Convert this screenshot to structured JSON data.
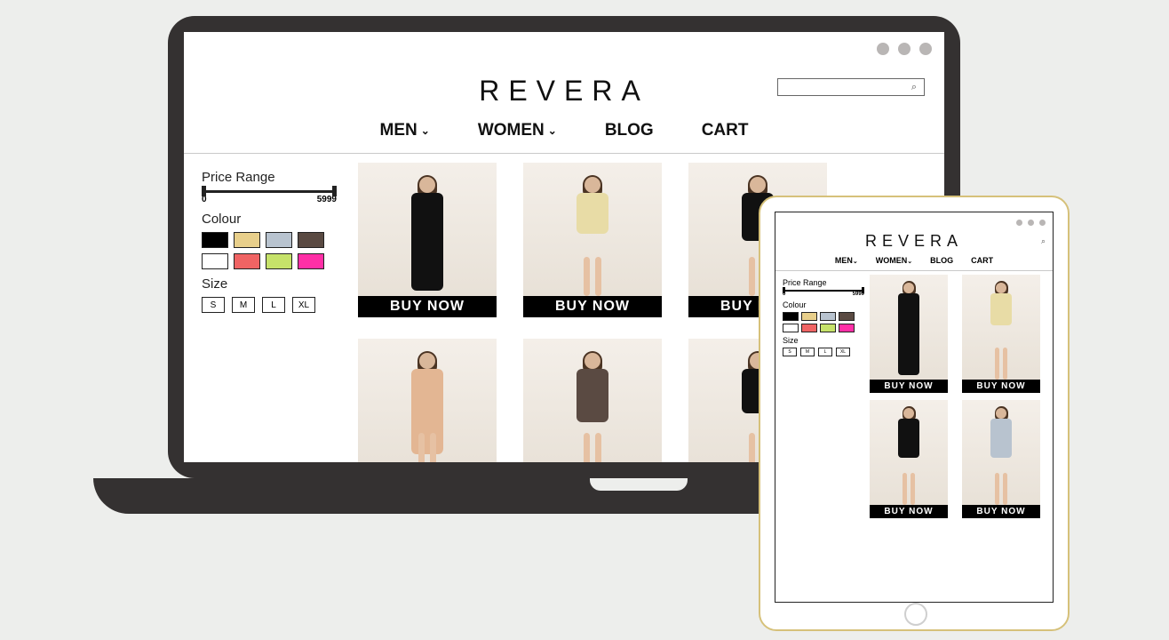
{
  "brand": "REVERA",
  "nav": {
    "men": "MEN",
    "women": "WOMEN",
    "blog": "BLOG",
    "cart": "CART"
  },
  "search": {
    "placeholder": ""
  },
  "filters": {
    "price_label": "Price Range",
    "price_min": "0",
    "price_max": "5999",
    "colour_label": "Colour",
    "colours": [
      "#000000",
      "#e8cf8b",
      "#b8c3cf",
      "#5a4a42",
      "#ffffff",
      "#f06464",
      "#c6e26a",
      "#ff2fa6"
    ],
    "size_label": "Size",
    "sizes": [
      "S",
      "M",
      "L",
      "XL"
    ]
  },
  "buy_label": "BUY NOW",
  "laptop_products": [
    {
      "dress_color": "#111",
      "dress_h": 110,
      "legs": false
    },
    {
      "dress_color": "#e8dca6",
      "dress_h": 46,
      "legs": true
    },
    {
      "dress_color": "#111",
      "dress_h": 54,
      "legs": true
    },
    {
      "dress_color": "#e3b693",
      "dress_h": 96,
      "legs": true,
      "slit": true
    },
    {
      "dress_color": "#5a4a42",
      "dress_h": 60,
      "legs": true
    },
    {
      "dress_color": "#111",
      "dress_h": 50,
      "legs": true
    }
  ],
  "tablet_products": [
    {
      "dress_color": "#111",
      "dress_h": 92,
      "legs": false
    },
    {
      "dress_color": "#e8dca6",
      "dress_h": 36,
      "legs": true
    },
    {
      "dress_color": "#111",
      "dress_h": 44,
      "legs": true
    },
    {
      "dress_color": "#b8c3cf",
      "dress_h": 44,
      "legs": true
    }
  ]
}
